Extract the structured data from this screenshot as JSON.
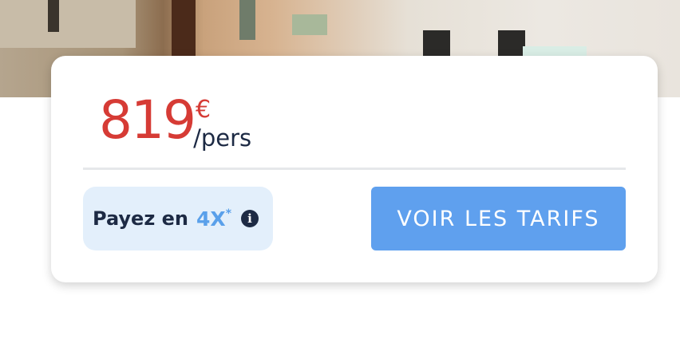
{
  "offer": {
    "price_amount": "819",
    "price_currency": "€",
    "price_unit": "/pers",
    "installment_label": "Payez en",
    "installment_count": "4X",
    "installment_asterisk": "*",
    "info_icon": "info-icon",
    "cta_label": "VOIR LES TARIFS"
  },
  "colors": {
    "price": "#d63b35",
    "text_dark": "#1d2a44",
    "accent_blue": "#5aa0ea",
    "badge_bg": "#e3effb",
    "cta_bg": "#5fa0ee"
  }
}
